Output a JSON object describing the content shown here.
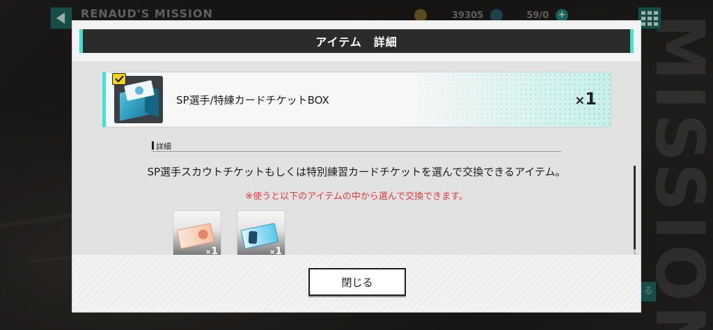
{
  "background": {
    "screen_title": "RENAUD'S MISSION",
    "coin_value": "39305",
    "gem_value": "59/0",
    "side_label": "る",
    "vertical_text": "MISSION"
  },
  "modal": {
    "title": "アイテム　詳細",
    "item": {
      "name": "SP選手/特練カードチケットBOX",
      "qty_prefix": "×",
      "qty_value": "1"
    },
    "section_label": "詳細",
    "description": "SP選手スカウトチケットもしくは特別練習カードチケットを選んで交換できるアイテム。",
    "note": "※使うと以下のアイテムの中から選んで交換できます。",
    "rewards": [
      {
        "qty_prefix": "×",
        "qty_value": "1"
      },
      {
        "qty_prefix": "×",
        "qty_value": "1"
      }
    ],
    "close_label": "閉じる"
  },
  "colors": {
    "accent": "#3de4d0",
    "header_bg": "#2b2b2b",
    "note_red": "#e23a3a",
    "badge_yellow": "#f4d40a"
  },
  "icons": {
    "back": "back-arrow-icon",
    "menu": "grid-menu-icon",
    "check": "check-icon"
  }
}
